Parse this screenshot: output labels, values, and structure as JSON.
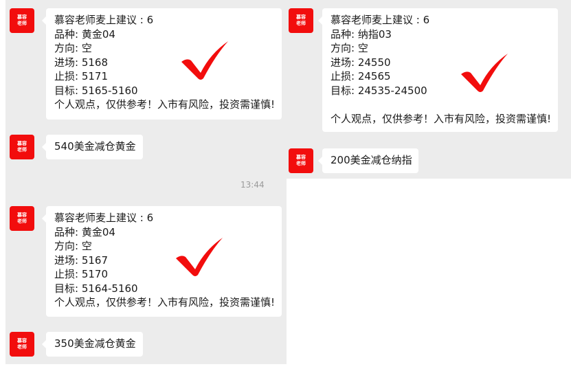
{
  "avatar_text": [
    "慕容",
    "老师"
  ],
  "colors": {
    "check": "#f20d0d",
    "avatar": "#f20d0d",
    "panel": "#ececec"
  },
  "left_panel": {
    "msg1": {
      "lines": [
        "慕容老师麦上建议 : 6",
        "品种:  黄金04",
        "方向: 空",
        "进场:  5168",
        "止损:  5171",
        "目标:  5165-5160",
        "个人观点，仅供参考！入市有风险，投资需谨慎!"
      ],
      "check_icon": "checkmark-icon"
    },
    "msg2": {
      "text": "540美金减仓黄金"
    },
    "timestamp": "13:44",
    "msg3": {
      "lines": [
        "慕容老师麦上建议 : 6",
        "品种:  黄金04",
        "方向: 空",
        "进场:  5167",
        "止损:  5170",
        "目标:  5164-5160",
        "个人观点，仅供参考！入市有风险，投资需谨慎!"
      ],
      "check_icon": "checkmark-icon"
    },
    "msg4": {
      "text": "350美金减仓黄金"
    }
  },
  "right_panel": {
    "msg1": {
      "lines": [
        "慕容老师麦上建议 : 6",
        "品种:  纳指03",
        "方向: 空",
        "进场:  24550",
        "止损:  24565",
        "目标:  24535-24500",
        "",
        "个人观点，仅供参考！入市有风险，投资需谨慎!"
      ],
      "check_icon": "checkmark-icon"
    },
    "msg2": {
      "text": "200美金减仓纳指"
    }
  }
}
